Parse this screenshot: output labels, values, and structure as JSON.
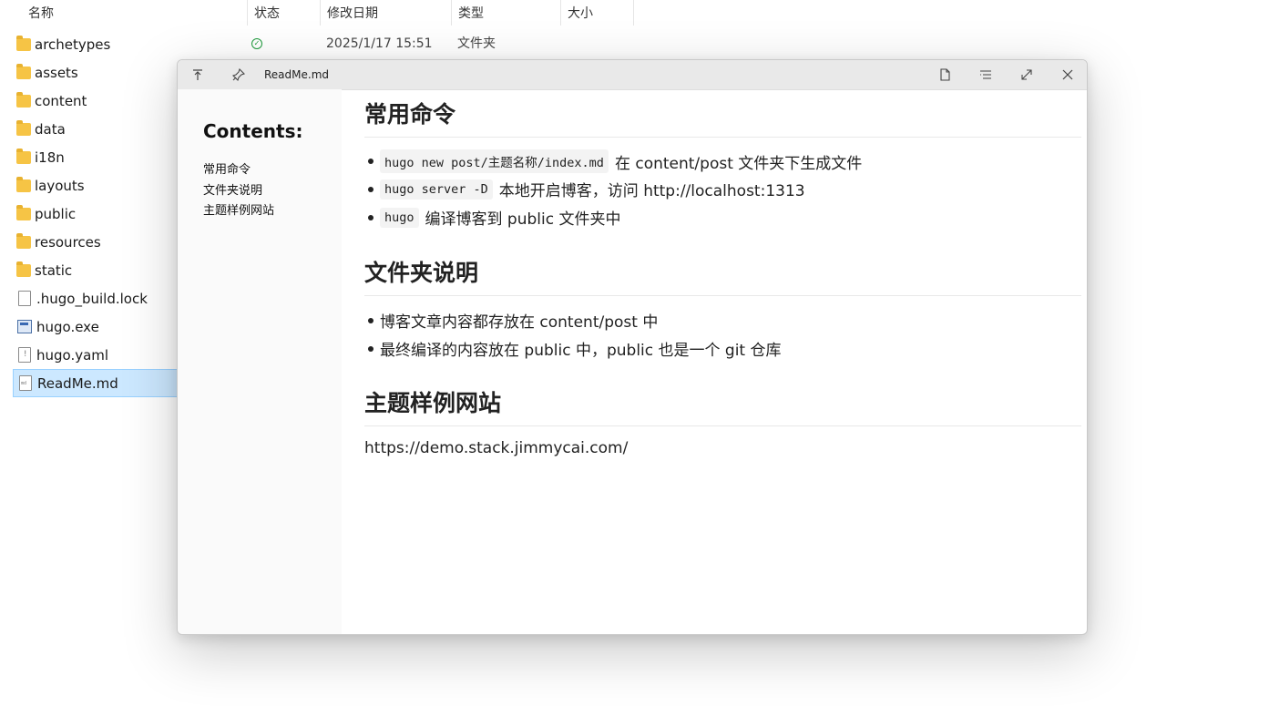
{
  "explorer": {
    "columns": [
      "名称",
      "状态",
      "修改日期",
      "类型",
      "大小"
    ],
    "first_row": {
      "date": "2025/1/17 15:51",
      "type": "文件夹"
    },
    "files": [
      {
        "name": "archetypes",
        "icon": "folder-icon"
      },
      {
        "name": "assets",
        "icon": "folder-icon"
      },
      {
        "name": "content",
        "icon": "folder-icon"
      },
      {
        "name": "data",
        "icon": "folder-icon"
      },
      {
        "name": "i18n",
        "icon": "folder-icon"
      },
      {
        "name": "layouts",
        "icon": "folder-icon"
      },
      {
        "name": "public",
        "icon": "folder-icon"
      },
      {
        "name": "resources",
        "icon": "folder-icon"
      },
      {
        "name": "static",
        "icon": "folder-icon"
      },
      {
        "name": ".hugo_build.lock",
        "icon": "file-icon"
      },
      {
        "name": "hugo.exe",
        "icon": "exe-icon"
      },
      {
        "name": "hugo.yaml",
        "icon": "yaml-file-icon"
      },
      {
        "name": "ReadMe.md",
        "icon": "markdown-file-icon"
      }
    ]
  },
  "preview": {
    "title": "ReadMe.md",
    "toc_title": "Contents:",
    "toc": [
      "常用命令",
      "文件夹说明",
      "主题样例网站"
    ],
    "sections": {
      "commands": {
        "heading": "常用命令",
        "items": [
          {
            "code": "hugo new post/主题名称/index.md",
            "text": "在 content/post 文件夹下生成文件"
          },
          {
            "code": "hugo server -D",
            "text": "本地开启博客，访问 http://localhost:1313"
          },
          {
            "code": "hugo",
            "text": "编译博客到 public 文件夹中"
          }
        ]
      },
      "folders": {
        "heading": "文件夹说明",
        "items": [
          "博客文章内容都存放在 content/post 中",
          "最终编译的内容放在 public 中，public 也是一个 git 仓库"
        ]
      },
      "theme": {
        "heading": "主题样例网站",
        "url": "https://demo.stack.jimmycai.com/"
      }
    }
  }
}
